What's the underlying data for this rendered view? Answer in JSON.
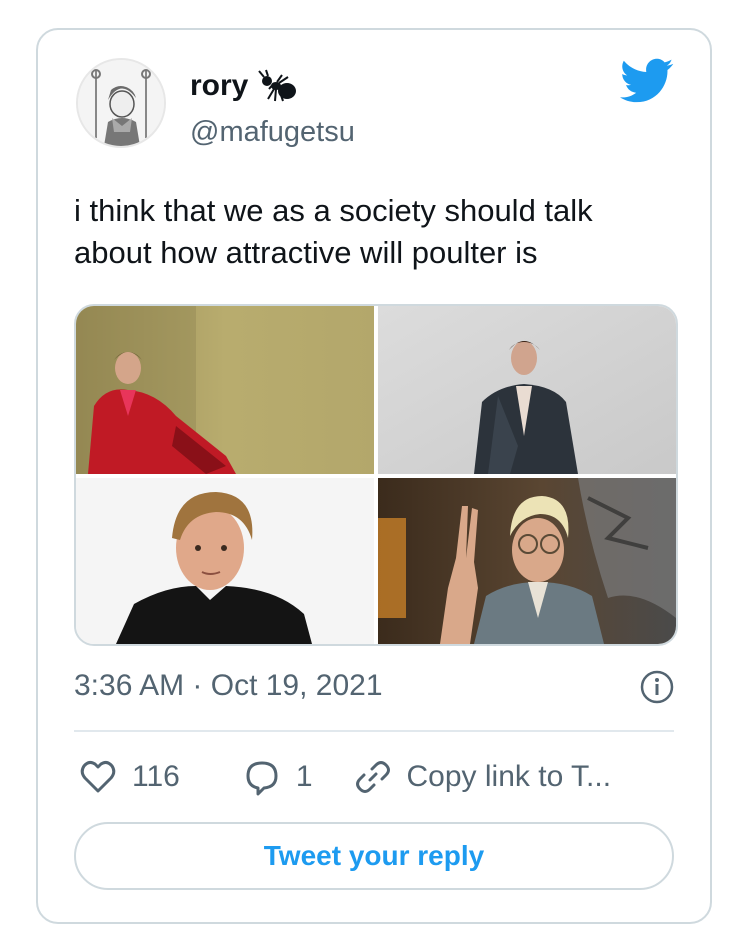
{
  "author": {
    "name": "rory",
    "handle": "@mafugetsu",
    "badge_icon": "ant-icon",
    "avatar_icon": "anime-avatar"
  },
  "brand": {
    "icon": "twitter-bird-icon",
    "color": "#1d9bf0"
  },
  "tweet": {
    "text_line1": "i think that we as a society should talk",
    "text_line2": "about how attractive will poulter is",
    "timestamp": "3:36 AM · Oct 19, 2021"
  },
  "media": {
    "photos": [
      {
        "name": "photo-red-suit"
      },
      {
        "name": "photo-dark-coat"
      },
      {
        "name": "photo-black-shirt"
      },
      {
        "name": "photo-peace-sign"
      }
    ]
  },
  "actions": {
    "like_count": "116",
    "reply_count": "1",
    "copy_link_label": "Copy link to T..."
  },
  "reply": {
    "button_label": "Tweet your reply"
  }
}
